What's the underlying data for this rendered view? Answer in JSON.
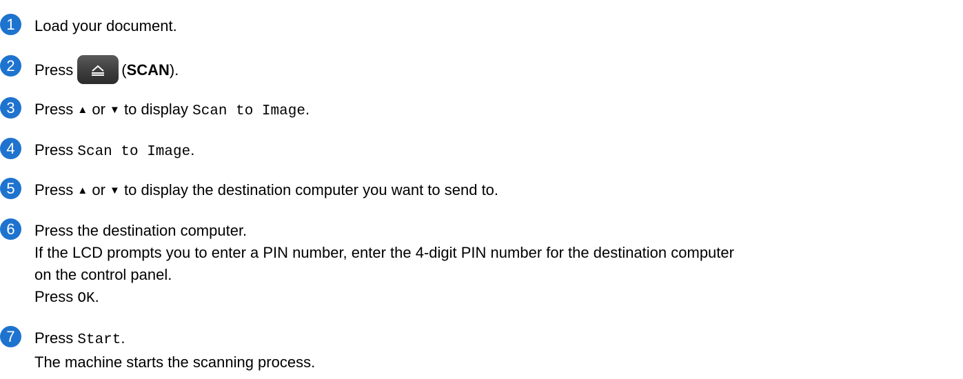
{
  "colors": {
    "badge": "#1e73ce",
    "text": "#000000",
    "button": "#3d3d3d"
  },
  "icons": {
    "scan_button": "scan-icon",
    "up_arrow": "up-triangle-icon",
    "down_arrow": "down-triangle-icon"
  },
  "steps": [
    {
      "number": "1",
      "text": "Load your document."
    },
    {
      "number": "2",
      "press": "Press",
      "open_paren": "(",
      "scan_label": "SCAN",
      "close_paren": ")."
    },
    {
      "number": "3",
      "press": "Press",
      "up": "▲",
      "or": "or",
      "down": "▼",
      "to_display": "to display",
      "option": "Scan to Image",
      "period": "."
    },
    {
      "number": "4",
      "press": "Press",
      "option": "Scan to Image",
      "period": "."
    },
    {
      "number": "5",
      "press": "Press",
      "up": "▲",
      "or": "or",
      "down": "▼",
      "rest": "to display the destination computer you want to send to."
    },
    {
      "number": "6",
      "line1": "Press the destination computer.",
      "line2": "If the LCD prompts you to enter a PIN number, enter the 4-digit PIN number for the destination computer",
      "line3": "on the control panel.",
      "press": "Press",
      "ok": "OK",
      "period": "."
    },
    {
      "number": "7",
      "press": "Press",
      "start": "Start",
      "period": ".",
      "line2": "The machine starts the scanning process."
    }
  ]
}
